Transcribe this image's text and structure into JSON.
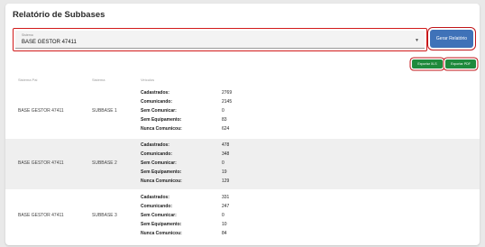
{
  "page": {
    "title": "Relatório de Subbases"
  },
  "filter": {
    "label": "Sistema",
    "value": "BASE GESTOR 47411"
  },
  "buttons": {
    "gerar": "Gerar Relatório",
    "xls": "Exportar XLS",
    "pdf": "Exportar PDF"
  },
  "table": {
    "headers": [
      "Sistema Pai",
      "Sistema",
      "Veículos"
    ],
    "rows": [
      {
        "pai": "BASE GESTOR 47411",
        "sistema": "SUBBASE 1",
        "stats": [
          [
            "Cadastrados:",
            "2769"
          ],
          [
            "Comunicando:",
            "2145"
          ],
          [
            "Sem Comunicar:",
            "0"
          ],
          [
            "Sem Equipamento:",
            "83"
          ],
          [
            "Nunca Comunicou:",
            "624"
          ]
        ]
      },
      {
        "pai": "BASE GESTOR 47411",
        "sistema": "SUBBASE 2",
        "stats": [
          [
            "Cadastrados:",
            "478"
          ],
          [
            "Comunicando:",
            "348"
          ],
          [
            "Sem Comunicar:",
            "0"
          ],
          [
            "Sem Equipamento:",
            "19"
          ],
          [
            "Nunca Comunicou:",
            "129"
          ]
        ]
      },
      {
        "pai": "BASE GESTOR 47411",
        "sistema": "SUBBASE 3",
        "stats": [
          [
            "Cadastrados:",
            "331"
          ],
          [
            "Comunicando:",
            "247"
          ],
          [
            "Sem Comunicar:",
            "0"
          ],
          [
            "Sem Equipamento:",
            "10"
          ],
          [
            "Nunca Comunicou:",
            "84"
          ]
        ]
      }
    ]
  }
}
